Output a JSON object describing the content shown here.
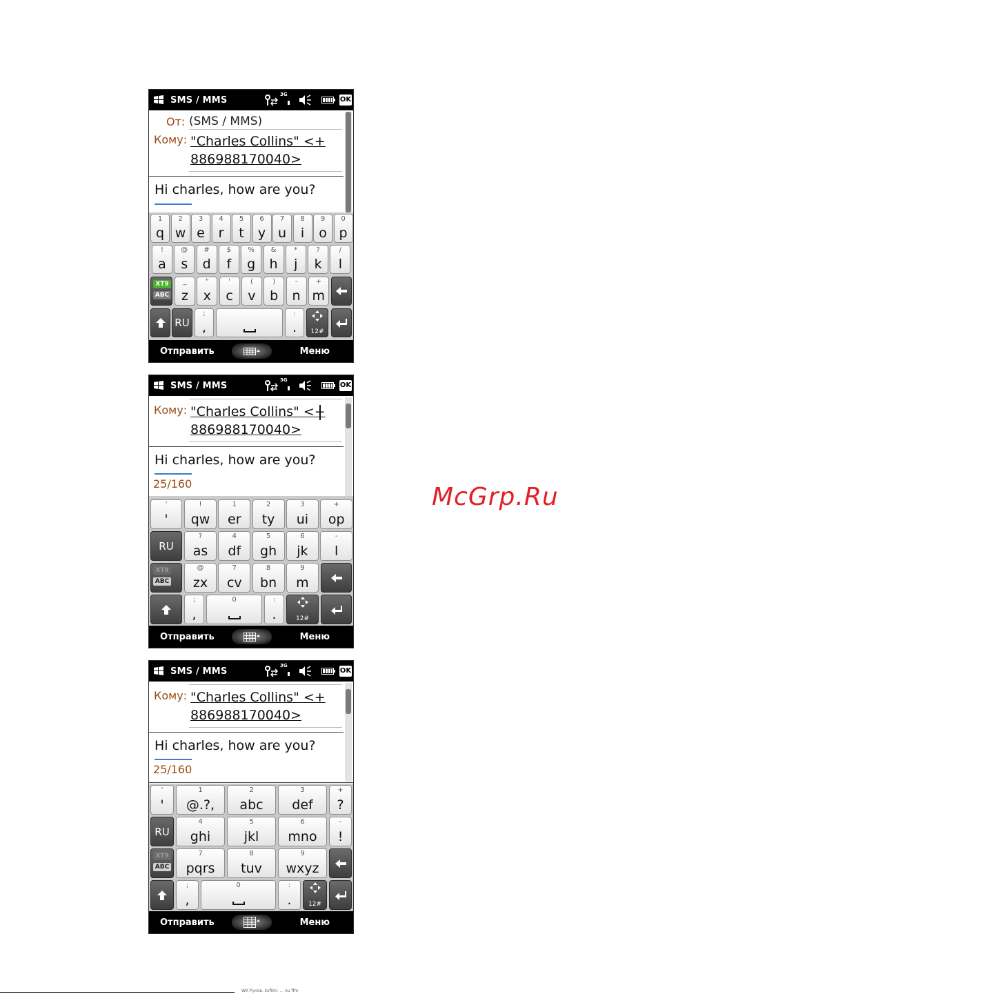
{
  "watermark": "McGrp.Ru",
  "footer_text": "WK Руков. kxfilm. ... ku ffm",
  "colors": {
    "label": "#9c4a12",
    "watermark": "#e31e24",
    "underline": "#3a7ad8",
    "xt9_active": "#4caf2a"
  },
  "screens": [
    {
      "status": {
        "title": "SMS / MMS",
        "network": "3G",
        "ok": "OK"
      },
      "from_label": "От:",
      "from_value": "(SMS / MMS)",
      "to_label": "Кому:",
      "to_line1": "\"Charles Collins\" <+",
      "to_line2": "886988170040>",
      "message": "Hi charles,  how are you?",
      "counter": "",
      "keyboard_type": "qwerty",
      "soft_left": "Отправить",
      "soft_right": "Меню",
      "keyboard": {
        "row1_sub": [
          "1",
          "2",
          "3",
          "4",
          "5",
          "6",
          "7",
          "8",
          "9",
          "0"
        ],
        "row1_main": [
          "q",
          "w",
          "e",
          "r",
          "t",
          "y",
          "u",
          "i",
          "o",
          "p"
        ],
        "row2_sub": [
          "!",
          "@",
          "#",
          "$",
          "%",
          "&",
          "*",
          "?",
          "/"
        ],
        "row2_main": [
          "a",
          "s",
          "d",
          "f",
          "g",
          "h",
          "j",
          "k",
          "l"
        ],
        "xt9_top": "XT9",
        "xt9_bottom": "ABC",
        "row3_sub": [
          "_",
          "\"",
          "'",
          "(",
          ")",
          "-",
          "+"
        ],
        "row3_main": [
          "z",
          "x",
          "c",
          "v",
          "b",
          "n",
          "m"
        ],
        "lang": "RU",
        "comma_sub": ";",
        "comma_main": ",",
        "period_sub": ":",
        "period_main": ".",
        "nav_sub": "12#"
      }
    },
    {
      "status": {
        "title": "SMS / MMS",
        "network": "3G",
        "ok": "OK"
      },
      "to_label": "Кому:",
      "to_line1": "\"Charles Collins\" <+",
      "to_line2": "886988170040>",
      "message": "Hi charles,  how are you?",
      "counter": "25/160",
      "keyboard_type": "compact",
      "soft_left": "Отправить",
      "soft_right": "Меню",
      "keyboard": {
        "apos_sub": "'",
        "apos_main": "'",
        "row1_sub": [
          "!",
          "1",
          "2",
          "3",
          "+"
        ],
        "row1_main": [
          "qw",
          "er",
          "ty",
          "ui",
          "op"
        ],
        "lang": "RU",
        "row2_sub": [
          "?",
          "4",
          "5",
          "6",
          "-"
        ],
        "row2_main": [
          "as",
          "df",
          "gh",
          "jk",
          "l"
        ],
        "xt9_top": "XT9",
        "xt9_bottom": "ABC",
        "row3_sub": [
          "@",
          "7",
          "8",
          "9"
        ],
        "row3_main": [
          "zx",
          "cv",
          "bn",
          "m"
        ],
        "comma_sub": ";",
        "comma_main": ",",
        "space_sub": "0",
        "period_sub": ":",
        "period_main": ".",
        "nav_sub": "12#"
      }
    },
    {
      "status": {
        "title": "SMS / MMS",
        "network": "3G",
        "ok": "OK"
      },
      "to_label": "Кому:",
      "to_line1": "\"Charles Collins\" <+",
      "to_line2": "886988170040>",
      "message": "Hi charles,  how are you?",
      "counter": "25/160",
      "keyboard_type": "phonepad",
      "soft_left": "Отправить",
      "soft_right": "Меню",
      "keyboard": {
        "apos_sub": "'",
        "apos_main": "'",
        "row1_sub": [
          "1",
          "2",
          "3"
        ],
        "row1_main": [
          "@.?,",
          "abc",
          "def"
        ],
        "q_sub": "+",
        "q_main": "?",
        "lang": "RU",
        "row2_sub": [
          "4",
          "5",
          "6"
        ],
        "row2_main": [
          "ghi",
          "jkl",
          "mno"
        ],
        "ex_sub": "-",
        "ex_main": "!",
        "xt9_top": "XT9",
        "xt9_bottom": "ABC",
        "row3_sub": [
          "7",
          "8",
          "9"
        ],
        "row3_main": [
          "pqrs",
          "tuv",
          "wxyz"
        ],
        "comma_sub": ";",
        "comma_main": ",",
        "space_sub": "0",
        "period_sub": ":",
        "period_main": ".",
        "nav_sub": "12#"
      }
    }
  ]
}
